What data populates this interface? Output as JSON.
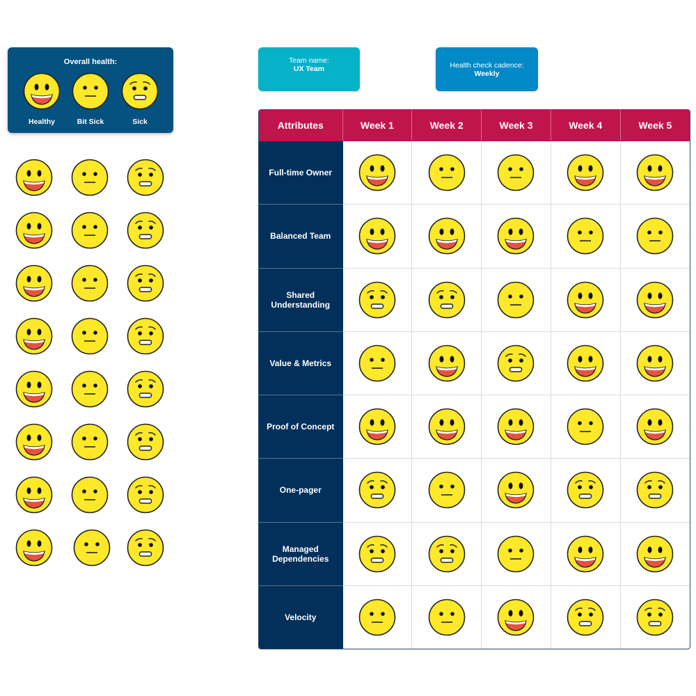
{
  "legend": {
    "title": "Overall health:",
    "items": [
      {
        "label": "Healthy",
        "face": "healthy"
      },
      {
        "label": "Bit Sick",
        "face": "bit-sick"
      },
      {
        "label": "Sick",
        "face": "sick"
      }
    ]
  },
  "team": {
    "key": "Team name:",
    "value": "UX Team"
  },
  "cadence": {
    "key": "Health check cadence:",
    "value": "Weekly"
  },
  "colors": {
    "legend_bg": "#05517f",
    "team_bg": "#07b2c9",
    "cadence_bg": "#0289c7",
    "header_bg": "#c0144d",
    "attr_bg": "#02305a",
    "face_fill": "#fde829",
    "mouth_red": "#e8513e"
  },
  "palette": {
    "rows": 8,
    "columns": [
      "healthy",
      "bit-sick",
      "sick"
    ]
  },
  "table": {
    "headers": [
      "Attributes",
      "Week 1",
      "Week 2",
      "Week 3",
      "Week 4",
      "Week 5"
    ],
    "rows": [
      {
        "attribute": "Full-time Owner",
        "weeks": [
          "healthy",
          "bit-sick",
          "bit-sick",
          "healthy",
          "healthy"
        ]
      },
      {
        "attribute": "Balanced Team",
        "weeks": [
          "healthy",
          "healthy",
          "healthy",
          "bit-sick",
          "bit-sick"
        ]
      },
      {
        "attribute": "Shared Understanding",
        "weeks": [
          "sick",
          "sick",
          "bit-sick",
          "healthy",
          "healthy"
        ]
      },
      {
        "attribute": "Value & Metrics",
        "weeks": [
          "bit-sick",
          "healthy",
          "sick",
          "healthy",
          "healthy"
        ]
      },
      {
        "attribute": "Proof of Concept",
        "weeks": [
          "healthy",
          "healthy",
          "healthy",
          "bit-sick",
          "healthy"
        ]
      },
      {
        "attribute": "One-pager",
        "weeks": [
          "sick",
          "bit-sick",
          "healthy",
          "sick",
          "sick"
        ]
      },
      {
        "attribute": "Managed Dependencies",
        "weeks": [
          "sick",
          "sick",
          "bit-sick",
          "healthy",
          "healthy"
        ]
      },
      {
        "attribute": "Velocity",
        "weeks": [
          "bit-sick",
          "bit-sick",
          "healthy",
          "sick",
          "sick"
        ]
      }
    ]
  }
}
